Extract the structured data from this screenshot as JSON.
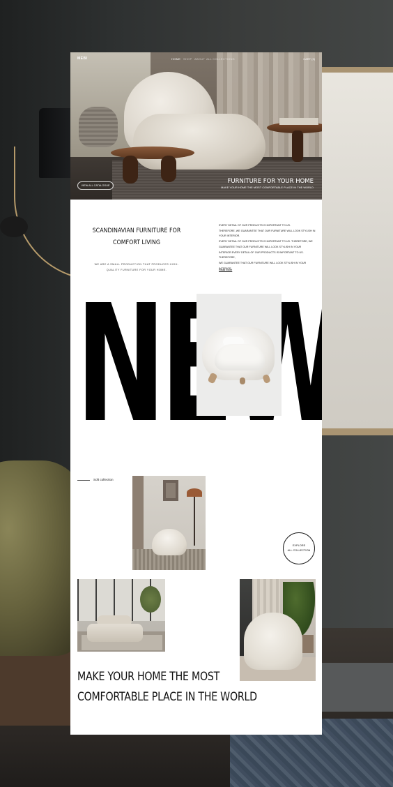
{
  "nav": {
    "logo": "MEBI",
    "items": [
      {
        "label": "HOME",
        "active": true
      },
      {
        "label": "SHOP",
        "active": false
      },
      {
        "label": "ABOUT",
        "active": false
      },
      {
        "label": "ALL COLLECTIONS",
        "active": false
      }
    ],
    "cart": "CART (2)"
  },
  "hero": {
    "title": "FURNITURE FOR YOUR HOME",
    "subtitle": "MAKE YOUR HOME THE MOST COMFORTABLE PLACE IN THE WORLD",
    "button": "VIEW ALL CATALOGUE"
  },
  "intro": {
    "title_line1": "SCANDINAVIAN FURNITURE FOR",
    "title_line2": "COMFORT LIVING",
    "note_line1": "WE ARE A SMALL PRODUCTION THAT PRODUCES HIGH-",
    "note_line2": "QUALITY FURNITURE FOR YOUR HOME.",
    "body": [
      "EVERY DETAIL OF OUR PRODUCTS IS IMPORTANT TO US.",
      "THEREFORE, WE GUARANTEE THAT OUR FURNITURE WILL LOOK STYLISH IN",
      "YOUR INTERIOR.",
      "EVERY DETAIL OF OUR PRODUCTS IS IMPORTANT TO US. THEREFORE, WE",
      "GUARANTEE THAT OUR FURNITURE WILL LOOK STYLISH IN YOUR",
      "INTERIOR EVERY DETAIL OF OUR PRODUCTS IS IMPORTANT TO US. THEREFORE,",
      "WE GUARANTEE THAT OUR FURNITURE WILL LOOK STYLISH IN YOUR INTERIOR"
    ],
    "read_more": "Read More"
  },
  "new_section": {
    "word": "NEW"
  },
  "collection": {
    "label": "Soft collection",
    "explore_line1": "EXPLORE",
    "explore_line2": "ALL COLLECTION"
  },
  "bottom": {
    "title_line1": "MAKE YOUR HOME THE MOST",
    "title_line2": "COMFORTABLE PLACE IN THE WORLD"
  },
  "colors": {
    "page_bg": "#ffffff",
    "text": "#111111",
    "backdrop": "#2b2c2c"
  },
  "icons": {
    "explore_circle": "circle-outline"
  }
}
